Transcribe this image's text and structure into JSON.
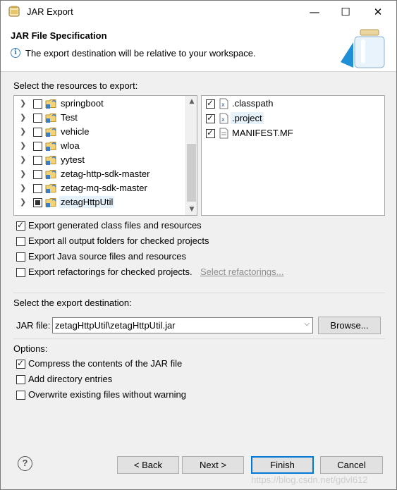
{
  "window": {
    "title": "JAR Export",
    "minimize": "—",
    "maximize": "☐",
    "close": "✕"
  },
  "banner": {
    "title": "JAR File Specification",
    "info_icon": "i",
    "message": "The export destination will be relative to your workspace."
  },
  "resources": {
    "label": "Select the resources to export:",
    "projects": [
      {
        "name": "springboot",
        "state": "unchecked"
      },
      {
        "name": "Test",
        "state": "unchecked"
      },
      {
        "name": "vehicle",
        "state": "unchecked"
      },
      {
        "name": "wloa",
        "state": "unchecked"
      },
      {
        "name": "yytest",
        "state": "unchecked"
      },
      {
        "name": "zetag-http-sdk-master",
        "state": "unchecked"
      },
      {
        "name": "zetag-mq-sdk-master",
        "state": "unchecked"
      },
      {
        "name": "zetagHttpUtil",
        "state": "partial"
      }
    ],
    "files": [
      {
        "name": ".classpath",
        "checked": true
      },
      {
        "name": ".project",
        "checked": true
      },
      {
        "name": "MANIFEST.MF",
        "checked": true
      }
    ]
  },
  "export_options": [
    {
      "label": "Export generated class files and resources",
      "checked": true
    },
    {
      "label": "Export all output folders for checked projects",
      "checked": false
    },
    {
      "label": "Export Java source files and resources",
      "checked": false
    },
    {
      "label": "Export refactorings for checked projects.",
      "checked": false
    }
  ],
  "select_refactorings_link": "Select refactorings...",
  "destination": {
    "label": "Select the export destination:",
    "jar_label": "JAR file:",
    "jar_value": "zetagHttpUtil\\zetagHttpUtil.jar",
    "browse": "Browse..."
  },
  "options": {
    "label": "Options:",
    "items": [
      {
        "label": "Compress the contents of the JAR file",
        "checked": true
      },
      {
        "label": "Add directory entries",
        "checked": false
      },
      {
        "label": "Overwrite existing files without warning",
        "checked": false
      }
    ]
  },
  "buttons": {
    "help": "?",
    "back": "< Back",
    "next": "Next >",
    "finish": "Finish",
    "cancel": "Cancel"
  },
  "watermark": "https://blog.csdn.net/gdvl612",
  "colors": {
    "selection": "#e5f1fb",
    "default_button_border": "#0078d7",
    "link": "#8d8d8d"
  }
}
